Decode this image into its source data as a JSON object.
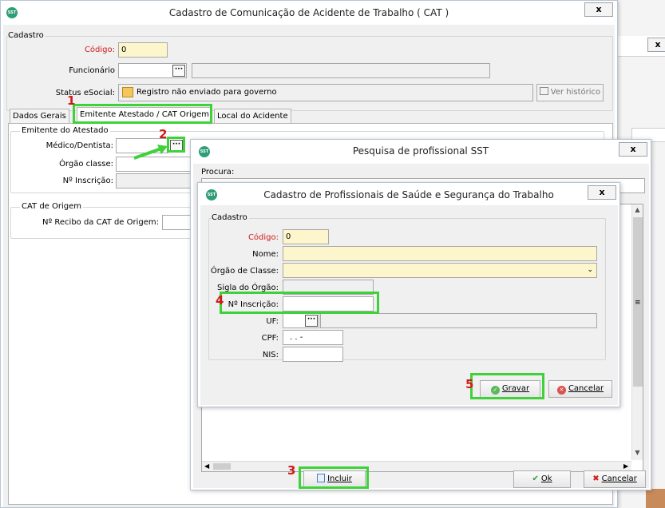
{
  "main": {
    "title": "Cadastro de Comunicação de Acidente de Trabalho ( CAT )",
    "close": "x",
    "cadastro_legend": "Cadastro",
    "codigo_label": "Código:",
    "codigo_value": "0",
    "funcionario_label": "Funcionário",
    "status_label": "Status eSocial:",
    "status_value": "Registro não enviado para governo",
    "ver_historico": "Ver histórico",
    "tabs": [
      "Dados Gerais",
      "Emitente Atestado / CAT Origem",
      "Local do Acidente"
    ],
    "emitente_legend": "Emitente do Atestado",
    "medico_label": "Médico/Dentista:",
    "orgao_label": "Órgão classe:",
    "inscricao_label": "Nº Inscrição:",
    "cat_origem_legend": "CAT de Origem",
    "recibo_label": "Nº Recibo da CAT de Origem:"
  },
  "background": {
    "close": "x"
  },
  "pesquisa": {
    "title": "Pesquisa de profissional SST",
    "close": "x",
    "procura_label": "Procura:",
    "incluir": "Incluir",
    "ok": "Ok",
    "cancelar": "Cancelar"
  },
  "profissional": {
    "title": "Cadastro de Profissionais de Saúde e Segurança do Trabalho",
    "close": "x",
    "cadastro_legend": "Cadastro",
    "codigo_label": "Código:",
    "codigo_value": "0",
    "nome_label": "Nome:",
    "orgao_label": "Órgão de Classe:",
    "sigla_label": "Sigla do Órgão:",
    "inscricao_label": "Nº Inscrição:",
    "uf_label": "UF:",
    "cpf_label": "CPF:",
    "cpf_value": ". . -",
    "nis_label": "NIS:",
    "gravar": "Gravar",
    "cancelar": "Cancelar"
  },
  "annotations": [
    "1",
    "2",
    "3",
    "4",
    "5"
  ],
  "colors": {
    "highlight": "#3fd13a",
    "annotation": "#d21919",
    "required_label": "#d21919",
    "field_required": "#fdf6cc"
  }
}
